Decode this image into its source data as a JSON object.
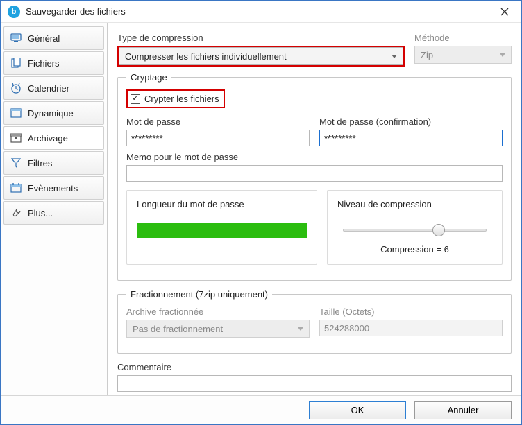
{
  "window": {
    "title": "Sauvegarder des fichiers"
  },
  "sidebar": {
    "items": [
      {
        "label": "Général"
      },
      {
        "label": "Fichiers"
      },
      {
        "label": "Calendrier"
      },
      {
        "label": "Dynamique"
      },
      {
        "label": "Archivage"
      },
      {
        "label": "Filtres"
      },
      {
        "label": "Evènements"
      },
      {
        "label": "Plus..."
      }
    ]
  },
  "compression": {
    "type_label": "Type de compression",
    "type_value": "Compresser les fichiers individuellement",
    "method_label": "Méthode",
    "method_value": "Zip"
  },
  "encryption": {
    "legend": "Cryptage",
    "checkbox_label": "Crypter les fichiers",
    "checked": true,
    "password_label": "Mot de passe",
    "password_value": "*********",
    "confirm_label": "Mot de passe (confirmation)",
    "confirm_value": "*********",
    "memo_label": "Memo pour le mot de passe",
    "memo_value": "",
    "strength_label": "Longueur du mot de passe",
    "level_label": "Niveau de compression",
    "level_value_text": "Compression = 6",
    "level_value": 6,
    "level_min": 0,
    "level_max": 9
  },
  "split": {
    "legend": "Fractionnement (7zip uniquement)",
    "archive_label": "Archive fractionnée",
    "archive_value": "Pas de fractionnement",
    "size_label": "Taille (Octets)",
    "size_value": "524288000"
  },
  "comment": {
    "label": "Commentaire",
    "value": ""
  },
  "footer": {
    "ok": "OK",
    "cancel": "Annuler"
  }
}
